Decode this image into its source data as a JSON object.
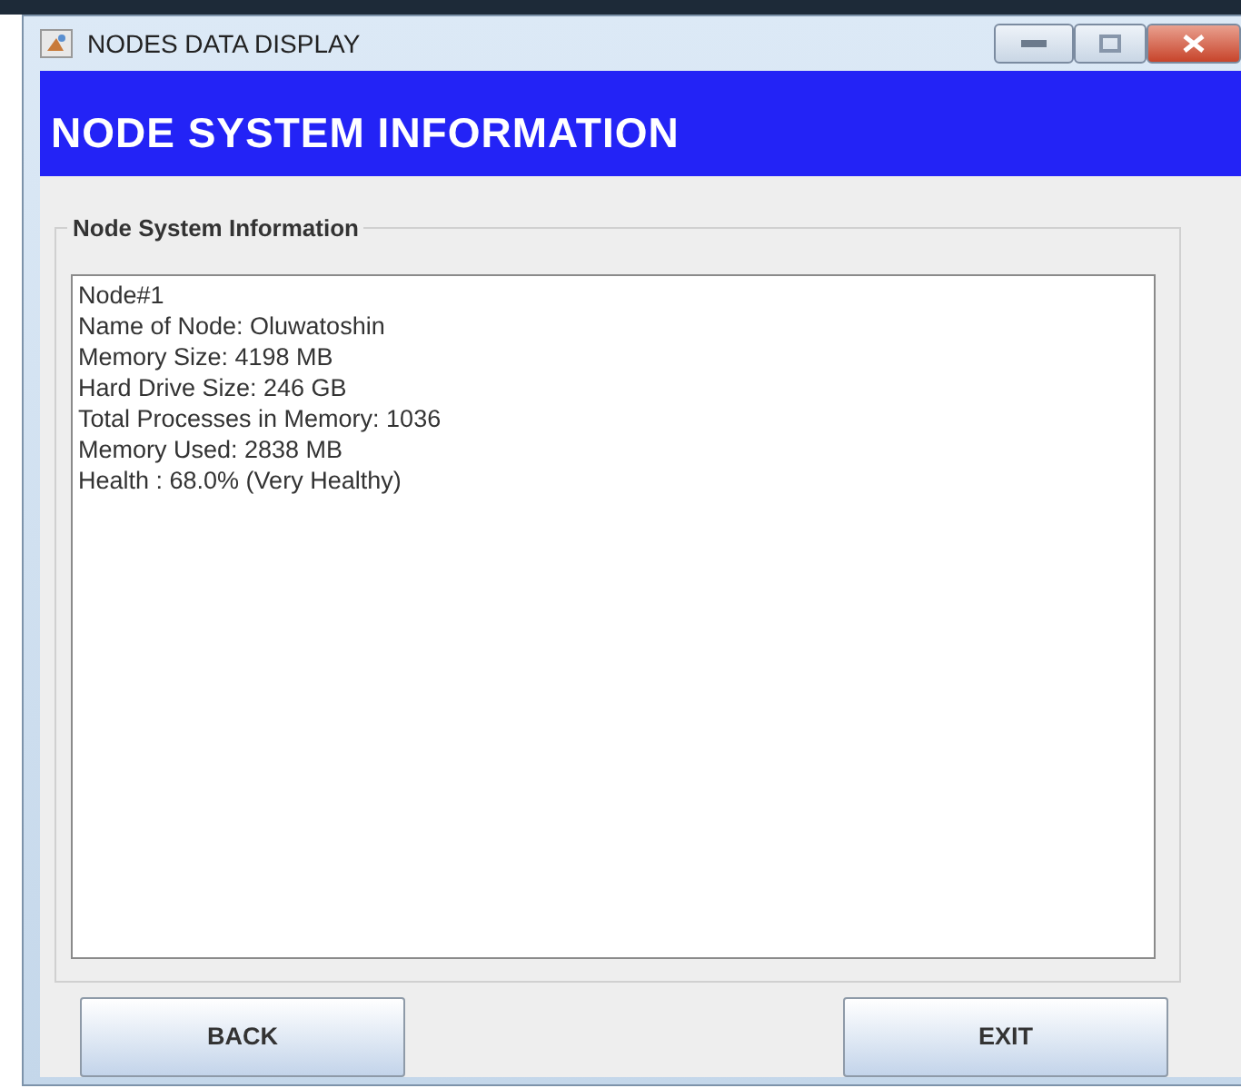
{
  "window": {
    "title": "NODES DATA DISPLAY"
  },
  "header": {
    "title": "NODE SYSTEM INFORMATION"
  },
  "group": {
    "title": "Node System Information",
    "lines": [
      "Node#1",
      "Name of Node: Oluwatoshin",
      "Memory Size: 4198 MB",
      "Hard Drive Size: 246 GB",
      "Total Processes in Memory: 1036",
      "Memory Used: 2838 MB",
      "Health : 68.0% (Very Healthy)"
    ]
  },
  "buttons": [
    "BACK",
    "EXIT"
  ]
}
